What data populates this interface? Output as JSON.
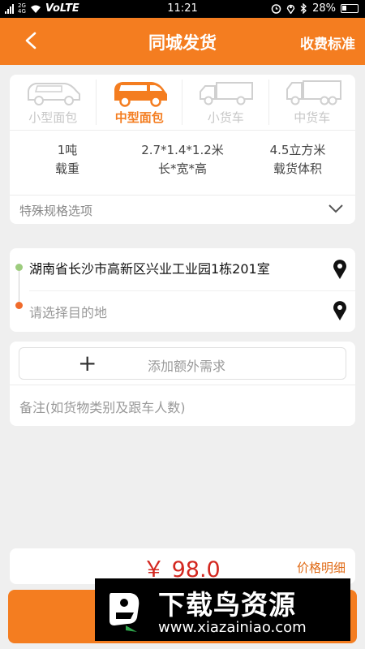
{
  "status_bar": {
    "network_top": "2G",
    "network_bottom": "4G",
    "carrier_label": "VoLTE",
    "time": "11:21",
    "battery": "28%",
    "icons": [
      "signal-icon",
      "wifi-icon",
      "alarm-icon",
      "location-icon",
      "bluetooth-icon",
      "battery-icon"
    ]
  },
  "header": {
    "title": "同城发货",
    "right_link": "收费标准",
    "bg_color": "#f47d20"
  },
  "vehicle": {
    "tabs": [
      {
        "label": "小型面包",
        "active": false
      },
      {
        "label": "中型面包",
        "active": true
      },
      {
        "label": "小货车",
        "active": false
      },
      {
        "label": "中货车",
        "active": false
      }
    ],
    "specs": [
      {
        "value": "1吨",
        "label": "载重"
      },
      {
        "value": "2.7*1.4*1.2米",
        "label": "长*宽*高"
      },
      {
        "value": "4.5立方米",
        "label": "载货体积"
      }
    ],
    "special_options_label": "特殊规格选项",
    "accent_color": "#f47d20"
  },
  "route": {
    "origin": "湖南省长沙市高新区兴业工业园1栋201室",
    "destination_placeholder": "请选择目的地",
    "origin_dot_color": "#9dcc7e",
    "destination_dot_color": "#f06b2b"
  },
  "extras": {
    "add_button_label": "添加额外需求",
    "remark_placeholder": "备注(如货物类别及跟车人数)"
  },
  "price": {
    "amount": "￥ 98.0",
    "detail_link": "价格明细",
    "color": "#d3271f"
  },
  "watermark": {
    "title": "下载鸟资源",
    "url": "www.xiazainiao.com"
  }
}
